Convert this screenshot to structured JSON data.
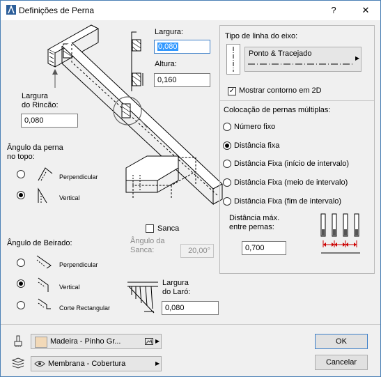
{
  "window": {
    "title": "Definições de Perna",
    "help_label": "?",
    "close_label": "✕"
  },
  "left": {
    "largura_label": "Largura:",
    "largura_value": "0,080",
    "altura_label": "Altura:",
    "altura_value": "0,160",
    "largura_rincao_label_1": "Largura",
    "largura_rincao_label_2": "do Rincão:",
    "largura_rincao_value": "0,080",
    "angulo_perna_label_1": "Ângulo da perna",
    "angulo_perna_label_2": "no topo:",
    "top_options": [
      {
        "label": "Perpendicular",
        "selected": false
      },
      {
        "label": "Vertical",
        "selected": true
      }
    ],
    "sanca_label": "Sanca",
    "sanca_checked": false,
    "angulo_sanca_label_1": "Ângulo da",
    "angulo_sanca_label_2": "Sanca:",
    "angulo_sanca_value": "20,00°",
    "angulo_beirado_label": "Ângulo de Beirado:",
    "eave_options": [
      {
        "label": "Perpendicular",
        "selected": false
      },
      {
        "label": "Vertical",
        "selected": true
      },
      {
        "label": "Corte Rectangular",
        "selected": false
      }
    ],
    "largura_laro_label_1": "Largura",
    "largura_laro_label_2": "do Laró:",
    "largura_laro_value": "0,080"
  },
  "right": {
    "tipo_linha_label": "Tipo de linha do eixo:",
    "linetype_name": "Ponto & Tracejado",
    "mostrar_contorno_label": "Mostrar contorno em 2D",
    "mostrar_contorno_checked": true,
    "colocacao_label": "Colocação de pernas múltiplas:",
    "placement_options": [
      {
        "label": "Número fixo",
        "selected": false
      },
      {
        "label": "Distância fixa",
        "selected": true
      },
      {
        "label": "Distância Fixa (início de intervalo)",
        "selected": false
      },
      {
        "label": "Distância Fixa (meio de intervalo)",
        "selected": false
      },
      {
        "label": "Distância Fixa (fim de intervalo)",
        "selected": false
      }
    ],
    "distancia_max_label_1": "Distância máx.",
    "distancia_max_label_2": "entre pernas:",
    "distancia_max_value": "0,700"
  },
  "bottom": {
    "material_name": "Madeira - Pinho Gr...",
    "material_swatch": "#f2d9b8",
    "membrane_name": "Membrana - Cobertura",
    "ok_label": "OK",
    "cancel_label": "Cancelar"
  }
}
